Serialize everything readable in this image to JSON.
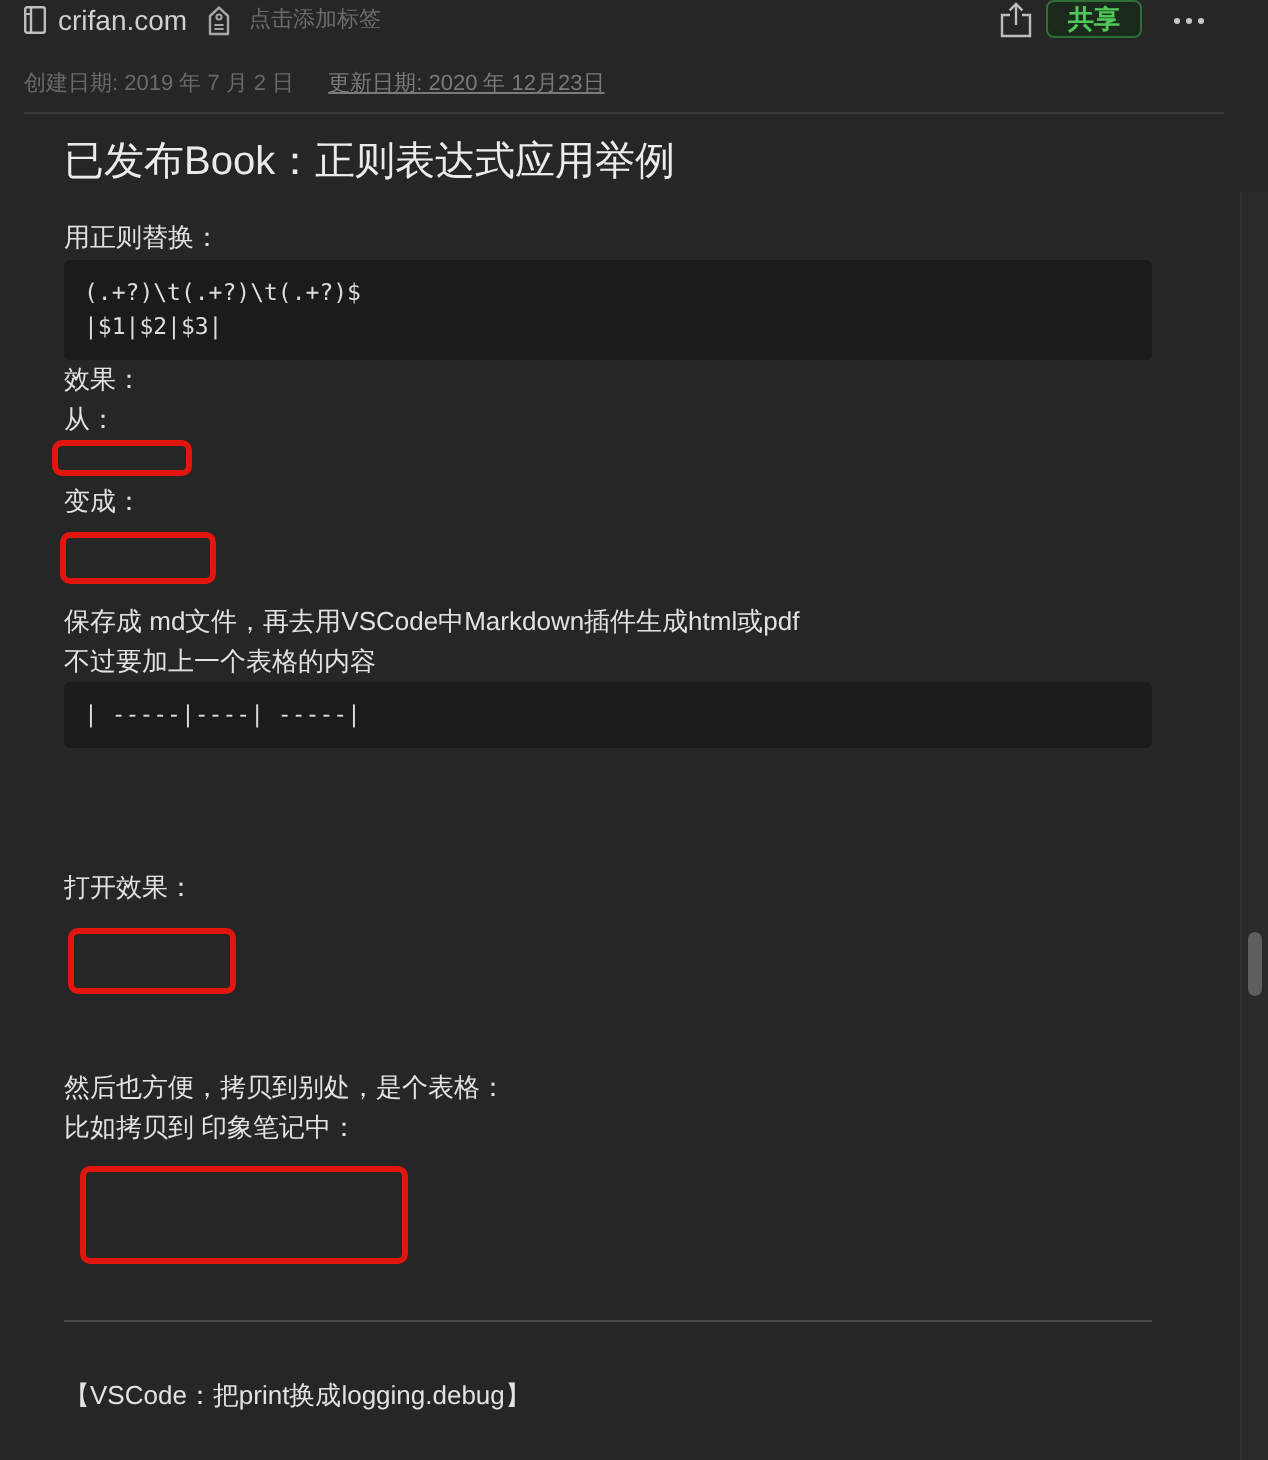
{
  "header": {
    "site_name": "crifan.com",
    "tag_prompt": "点击添加标签",
    "share_button": "共享"
  },
  "dates": {
    "created": "创建日期: 2019 年 7 月 2 日",
    "updated": "更新日期: 2020 年 12月23日"
  },
  "note": {
    "title": "已发布Book：正则表达式应用举例",
    "blocks": [
      {
        "kind": "text",
        "lines": [
          "用正则替换："
        ]
      },
      {
        "kind": "code",
        "lines": [
          "(.+?)\\t(.+?)\\t(.+?)$",
          "|$1|$2|$3|"
        ]
      },
      {
        "kind": "text",
        "lines": [
          "效果：",
          "从："
        ]
      },
      {
        "kind": "frame"
      },
      {
        "kind": "text",
        "lines": [
          "变成："
        ]
      },
      {
        "kind": "frame"
      },
      {
        "kind": "text",
        "lines": [
          "保存成 md文件，再去用VSCode中Markdown插件生成html或pdf",
          "不过要加上一个表格的内容"
        ]
      },
      {
        "kind": "code",
        "lines": [
          "| -----|----| -----|"
        ]
      },
      {
        "kind": "text",
        "lines": [
          "打开效果："
        ]
      },
      {
        "kind": "frame"
      },
      {
        "kind": "text",
        "lines": [
          "然后也方便，拷贝到别处，是个表格：",
          "比如拷贝到 印象笔记中："
        ]
      },
      {
        "kind": "frame"
      },
      {
        "kind": "divider"
      },
      {
        "kind": "text",
        "lines": [
          "【VSCode：把print换成logging.debug】"
        ]
      }
    ]
  }
}
